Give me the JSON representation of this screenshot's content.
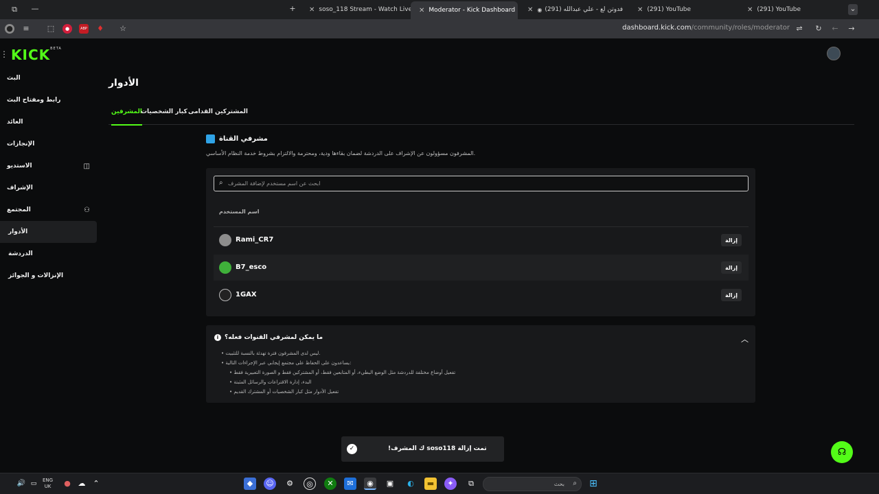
{
  "browser": {
    "tabs": [
      {
        "title": "soso_118 Stream - Watch Live o",
        "fav_color": "#53fc18"
      },
      {
        "title": "Moderator - Kick Dashboard",
        "fav_color": "#53fc18"
      },
      {
        "title": "(291) فدوتن لع - علي عبدالله",
        "fav_color": "#ff0000"
      },
      {
        "title": "(291) YouTube",
        "fav_color": "#ff0000"
      },
      {
        "title": "(291) YouTube",
        "fav_color": "#ff0000"
      }
    ],
    "url_host": "dashboard.kick.com",
    "url_path": "/community/roles/moderator"
  },
  "logo": {
    "text": "KICK",
    "badge": "BETA"
  },
  "sidebar": {
    "items": [
      {
        "label": "البث"
      },
      {
        "label": "رابط ومفتاح البث"
      },
      {
        "label": "العائد"
      },
      {
        "label": "الإنجازات"
      },
      {
        "label": "الاستديو"
      },
      {
        "label": "الإشراف"
      },
      {
        "label": "المجتمع"
      },
      {
        "label": "الأدوار"
      },
      {
        "label": "الدردشة"
      },
      {
        "label": "الإنزالات و الجوائز"
      }
    ]
  },
  "page": {
    "title": "الأدوار",
    "tabs": [
      {
        "label": "المشرفين"
      },
      {
        "label": "كبار الشخصيات"
      },
      {
        "label": "المشتركين القدامى"
      }
    ]
  },
  "section": {
    "title": "مشرفي القناة",
    "desc": "المشرفون مسؤولون عن الإشراف على الدردشة لضمان بقاءها ودية، ومحترمة والالتزام بشروط خدمة النظام الأساسي.",
    "search_placeholder": "ابحث عن اسم مستخدم لإضافة المشرف",
    "col_header": "اسم المستخدم",
    "moderators": [
      {
        "name": "Rami_CR7",
        "remove": "إزالة"
      },
      {
        "name": "B7_esco",
        "remove": "إزالة"
      },
      {
        "name": "1GAX",
        "remove": "إزالة"
      }
    ]
  },
  "faq": {
    "title": "ما يمكن لمشرفي القنوات فعله؟",
    "lines": [
      "ليس لدى المشرفون فترة تهدئة بالنسبة للتثبيت.",
      "يساعدون على الحفاظ على مجتمع إيجابي عبر الإجراءات التالية:"
    ],
    "sub_lines": [
      "تفعيل أوضاع مختلفة للدردشة مثل الوضع البطيء، أو المتابعين فقط، أو المشتركين فقط و الصورة التعبيرية فقط",
      "البدء، إدارة الاقتراعات والرسائل المثبتة",
      "تفعيل الأدوار مثل كبار الشخصيات أو المشترك القديم"
    ]
  },
  "toast": {
    "message": "!ك المشرف soso118 تمت إزالة"
  },
  "taskbar": {
    "lang": "ENG",
    "region": "UK",
    "search_label": "بحث"
  }
}
